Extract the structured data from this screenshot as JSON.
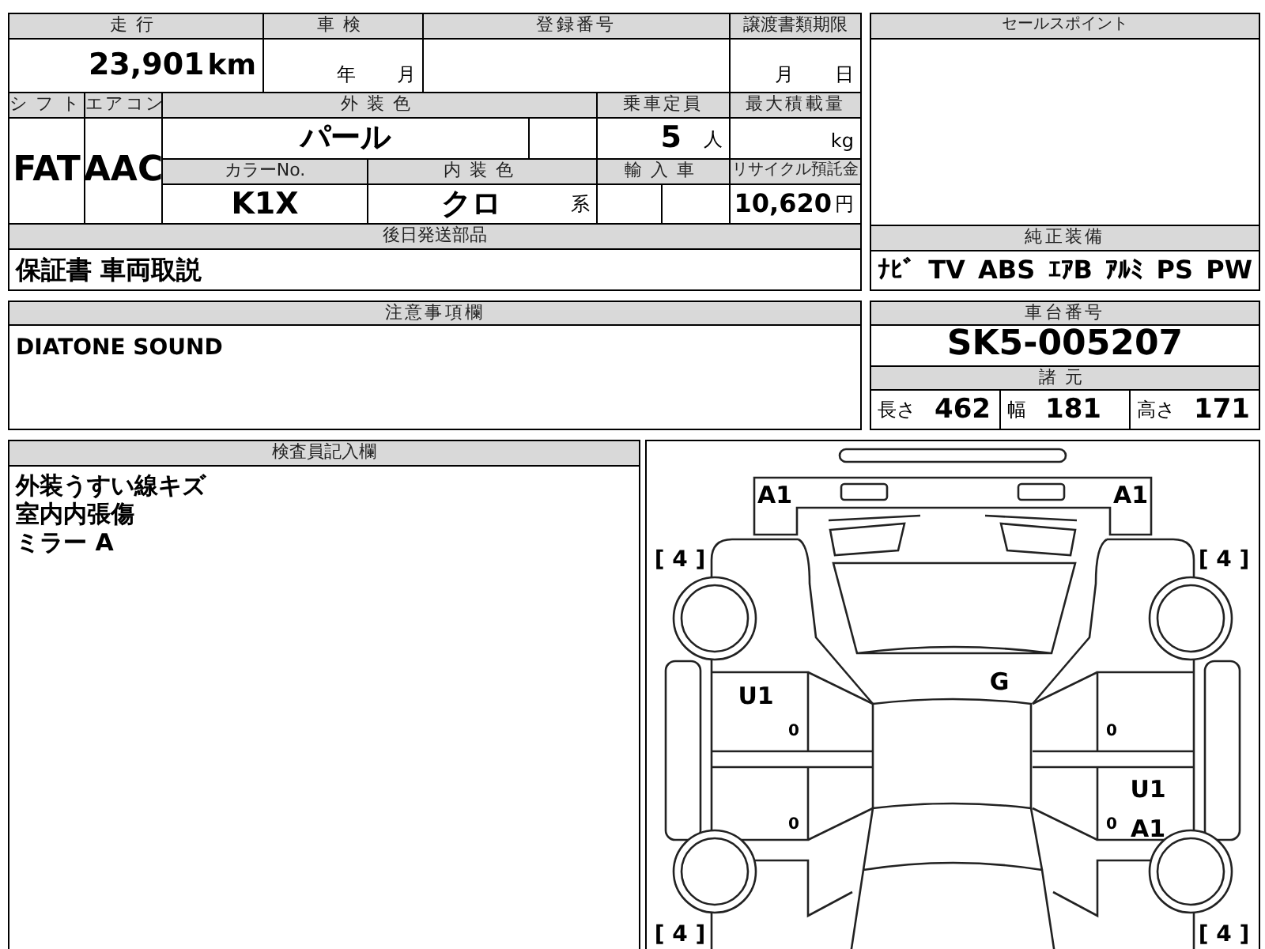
{
  "top_form": {
    "mileage": {
      "label": "走行",
      "value": "23,901",
      "unit": "km"
    },
    "inspection": {
      "label": "車検",
      "year_unit": "年",
      "month_unit": "月"
    },
    "registration_number": {
      "label": "登録番号"
    },
    "transfer_deadline": {
      "label": "譲渡書類期限",
      "month_unit": "月",
      "day_unit": "日"
    },
    "shift": {
      "label": "シフト",
      "value": "FAT"
    },
    "air_conditioner": {
      "label": "エアコン",
      "value": "AAC"
    },
    "exterior_color": {
      "label": "外装色",
      "value": "パール"
    },
    "capacity": {
      "label": "乗車定員",
      "value": "5",
      "unit": "人"
    },
    "max_load": {
      "label": "最大積載量",
      "unit": "kg"
    },
    "color_number": {
      "label": "カラーNo.",
      "value": "K1X"
    },
    "interior_color": {
      "label": "内装色",
      "value": "クロ",
      "unit": "系"
    },
    "imported": {
      "label": "輸入車"
    },
    "recycle_deposit": {
      "label": "リサイクル預託金",
      "value": "10,620",
      "unit": "円"
    },
    "parts_sent_later": {
      "label": "後日発送部品",
      "value": "保証書 車両取説"
    }
  },
  "sales_point": {
    "label": "セールスポイント"
  },
  "factory_equipment": {
    "label": "純正装備",
    "items": [
      "ﾅﾋﾞ",
      "TV",
      "ABS",
      "ｴｱB",
      "ｱﾙﾐ",
      "PS",
      "PW"
    ]
  },
  "notes": {
    "label": "注意事項欄",
    "text": "DIATONE SOUND"
  },
  "chassis": {
    "label": "車台番号",
    "value": "SK5-005207"
  },
  "specs": {
    "label": "諸元",
    "items": [
      {
        "label": "長さ",
        "value": "462"
      },
      {
        "label": "幅",
        "value": "181"
      },
      {
        "label": "高さ",
        "value": "171"
      }
    ]
  },
  "inspector_notes": {
    "label": "検査員記入欄",
    "lines": [
      "外装うすい線キズ",
      "室内内張傷",
      "ミラー A"
    ]
  },
  "damage_map": {
    "marks": [
      {
        "kind": "damage",
        "text": "A1"
      },
      {
        "kind": "damage",
        "text": "A1"
      },
      {
        "kind": "tire",
        "text": "[ 4 ]"
      },
      {
        "kind": "tire",
        "text": "[ 4 ]"
      },
      {
        "kind": "damage",
        "text": "U1"
      },
      {
        "kind": "damage",
        "text": "G"
      },
      {
        "kind": "door",
        "text": "0"
      },
      {
        "kind": "door",
        "text": "0"
      },
      {
        "kind": "damage",
        "text": "U1"
      },
      {
        "kind": "door",
        "text": "0"
      },
      {
        "kind": "door",
        "text": "0"
      },
      {
        "kind": "damage",
        "text": "A1"
      },
      {
        "kind": "tire",
        "text": "[ 4 ]"
      },
      {
        "kind": "tire",
        "text": "[ 4 ]"
      }
    ]
  }
}
